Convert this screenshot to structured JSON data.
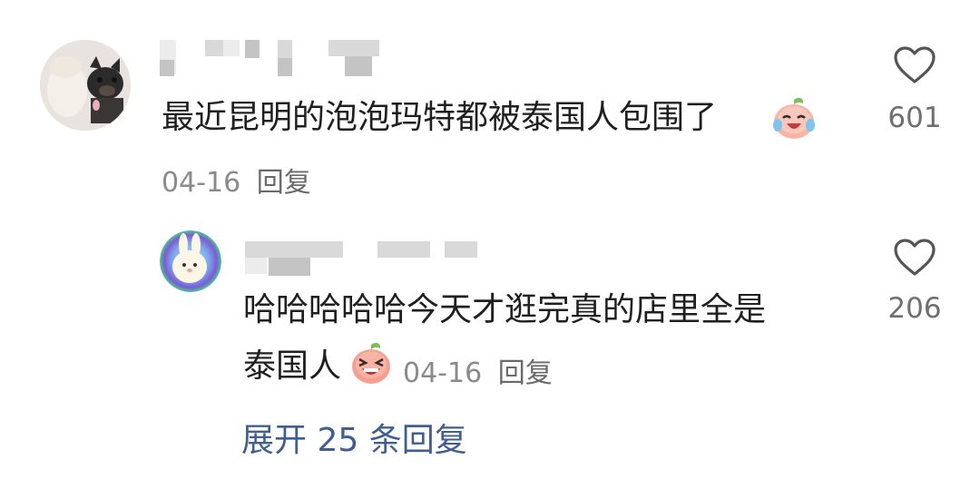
{
  "comments": [
    {
      "text": "最近昆明的泡泡玛特都被泰国人包围了",
      "date": "04-16",
      "reply_label": "回复",
      "likes": "601",
      "emoji": "crying-laughing-peach-emoji"
    }
  ],
  "reply": {
    "text_line1": "哈哈哈哈哈今天才逛完真的店里全是",
    "text_line2": "泰国人",
    "date": "04-16",
    "reply_label": "回复",
    "likes": "206",
    "emoji": "laughing-peach-emoji"
  },
  "expand_replies": "展开 25 条回复",
  "colors": {
    "text": "#1f1f1f",
    "meta": "#8a8a8a",
    "link": "#3f5f8f",
    "background": "#ffffff"
  }
}
